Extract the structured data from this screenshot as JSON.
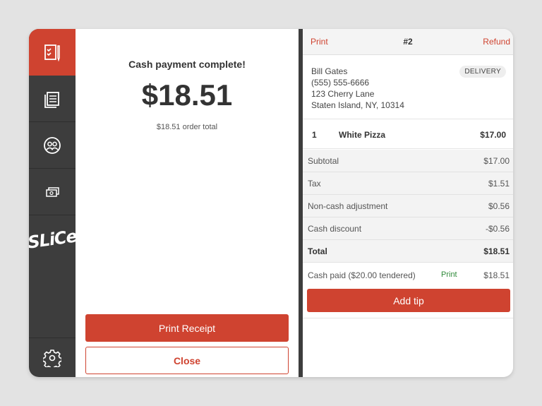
{
  "sidebar": {
    "items": [
      {
        "icon": "order-pad-icon",
        "active": true
      },
      {
        "icon": "orders-list-icon",
        "active": false
      },
      {
        "icon": "customers-icon",
        "active": false
      },
      {
        "icon": "cash-icon",
        "active": false
      }
    ],
    "logo": "SLiCe",
    "settings_icon": "gear-icon"
  },
  "main": {
    "title": "Cash payment complete!",
    "amount": "$18.51",
    "subtitle": "$18.51 order total",
    "print_receipt_label": "Print Receipt",
    "close_label": "Close"
  },
  "order": {
    "print_label": "Print",
    "number": "#2",
    "refund_label": "Refund",
    "customer": {
      "name": "Bill Gates",
      "phone": "(555) 555-6666",
      "address1": "123 Cherry Lane",
      "address2": "Staten Island, NY, 10314"
    },
    "type_badge": "DELIVERY",
    "items": [
      {
        "qty": "1",
        "name": "White Pizza",
        "price": "$17.00"
      }
    ],
    "summary": [
      {
        "label": "Subtotal",
        "value": "$17.00"
      },
      {
        "label": "Tax",
        "value": "$1.51"
      },
      {
        "label": "Non-cash adjustment",
        "value": "$0.56"
      },
      {
        "label": "Cash discount",
        "value": "-$0.56"
      },
      {
        "label": "Total",
        "value": "$18.51"
      }
    ],
    "payment": {
      "label": "Cash paid ($20.00 tendered)",
      "print_label": "Print",
      "value": "$18.51"
    },
    "add_tip_label": "Add tip"
  },
  "colors": {
    "accent": "#cf4330",
    "sidebar": "#3d3d3d",
    "print_green": "#2f8a3a"
  }
}
